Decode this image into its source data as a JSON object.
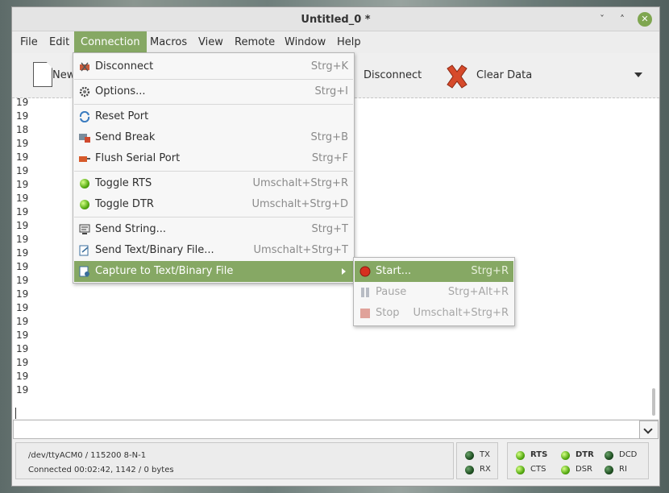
{
  "window": {
    "title": "Untitled_0 *",
    "minimize_glyph": "ˇ",
    "maximize_glyph": "˄",
    "close_glyph": "✕"
  },
  "menubar": {
    "items": [
      "File",
      "Edit",
      "Connection",
      "Macros",
      "View",
      "Remote",
      "Window",
      "Help"
    ]
  },
  "toolbar": {
    "new_label": "New",
    "disconnect_label": "Disconnect",
    "clear_label": "Clear Data",
    "clear_icon": "red-x-icon",
    "arrow_icon": "chevron-down-icon"
  },
  "terminal": {
    "lines": [
      "19",
      "19",
      "18",
      "19",
      "19",
      "19",
      "19",
      "19",
      "19",
      "19",
      "19",
      "19",
      "19",
      "19",
      "19",
      "19",
      "19",
      "19",
      "19",
      "19",
      "19",
      "19"
    ]
  },
  "connection_menu": {
    "items": [
      {
        "label": "Disconnect",
        "shortcut": "Strg+K",
        "icon": "disconnect-icon"
      },
      {
        "label": "Options...",
        "shortcut": "Strg+I",
        "icon": "gear-icon"
      },
      {
        "label": "Reset Port",
        "shortcut": "",
        "icon": "reset-icon"
      },
      {
        "label": "Send Break",
        "shortcut": "Strg+B",
        "icon": "break-icon"
      },
      {
        "label": "Flush Serial Port",
        "shortcut": "Strg+F",
        "icon": "flush-icon"
      },
      {
        "label": "Toggle RTS",
        "shortcut": "Umschalt+Strg+R",
        "icon": "green-led-icon"
      },
      {
        "label": "Toggle DTR",
        "shortcut": "Umschalt+Strg+D",
        "icon": "green-led-icon"
      },
      {
        "label": "Send String...",
        "shortcut": "Strg+T",
        "icon": "send-string-icon"
      },
      {
        "label": "Send Text/Binary File...",
        "shortcut": "Umschalt+Strg+T",
        "icon": "send-file-icon"
      },
      {
        "label": "Capture to Text/Binary File",
        "shortcut": "",
        "icon": "capture-icon"
      }
    ]
  },
  "capture_submenu": {
    "items": [
      {
        "label": "Start...",
        "shortcut": "Strg+R",
        "icon": "record-icon",
        "enabled": true
      },
      {
        "label": "Pause",
        "shortcut": "Strg+Alt+R",
        "icon": "pause-icon",
        "enabled": false
      },
      {
        "label": "Stop",
        "shortcut": "Umschalt+Strg+R",
        "icon": "stop-icon",
        "enabled": false
      }
    ]
  },
  "status": {
    "port": "/dev/ttyACM0 / 115200 8-N-1",
    "connection": "Connected 00:02:42, 1142 / 0 bytes"
  },
  "leds": {
    "tx": "TX",
    "rx": "RX",
    "rts": "RTS",
    "cts": "CTS",
    "dtr": "DTR",
    "dsr": "DSR",
    "dcd": "DCD",
    "ri": "RI"
  },
  "colors": {
    "accent": "#86a864",
    "led_on": "#55aa11",
    "led_off": "#1f4f22",
    "clear_icon": "#d64a2b"
  }
}
